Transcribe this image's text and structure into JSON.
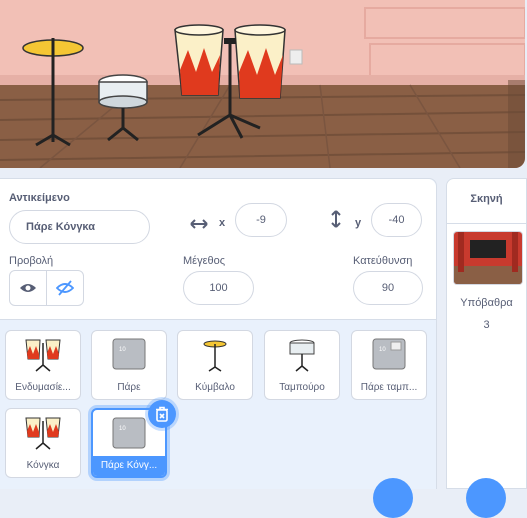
{
  "stage": {
    "scene": "drum-kit-stage"
  },
  "sprite_info": {
    "sprite_label": "Αντικείμενο",
    "sprite_name": "Πάρε Κόνγκα",
    "x_label": "x",
    "x_value": "-9",
    "y_label": "y",
    "y_value": "-40",
    "show_label": "Προβολή",
    "size_label": "Μέγεθος",
    "size_value": "100",
    "direction_label": "Κατεύθυνση",
    "direction_value": "90"
  },
  "sprites": [
    {
      "name": "Ενδυμασίε...",
      "icon": "conga-icon",
      "selected": false
    },
    {
      "name": "Πάρε",
      "icon": "grey-box-icon",
      "selected": false
    },
    {
      "name": "Κύμβαλο",
      "icon": "cymbal-icon",
      "selected": false
    },
    {
      "name": "Ταμπούρο",
      "icon": "snare-drum-icon",
      "selected": false
    },
    {
      "name": "Πάρε ταμπ...",
      "icon": "grey-box-icon",
      "selected": false
    },
    {
      "name": "Κόνγκα",
      "icon": "conga-icon",
      "selected": false
    },
    {
      "name": "Πάρε Κόνγ...",
      "icon": "grey-box-icon",
      "selected": true
    }
  ],
  "stage_panel": {
    "title": "Σκηνή",
    "backdrops_label": "Υπόβαθρα",
    "backdrops_count": "3"
  },
  "colors": {
    "accent": "#4c97ff",
    "text": "#575e75",
    "pane_bg": "#e9f1fc"
  }
}
